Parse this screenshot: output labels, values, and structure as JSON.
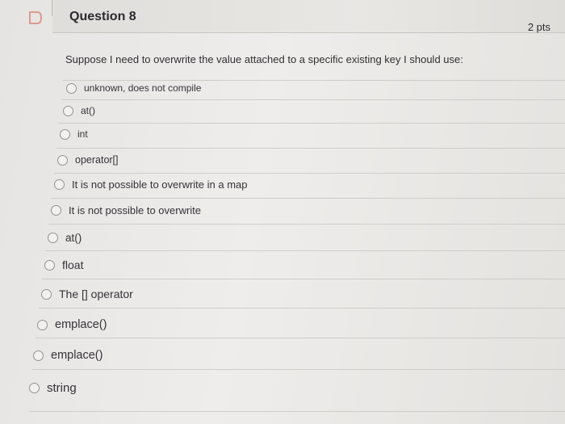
{
  "question": {
    "title": "Question 8",
    "points": "2 pts",
    "prompt": "Suppose I need to overwrite the value attached to a specific existing key I should use:"
  },
  "options": [
    {
      "label": "unknown, does not compile"
    },
    {
      "label": "at()"
    },
    {
      "label": "int"
    },
    {
      "label": "operator[]"
    },
    {
      "label": "It is not possible to overwrite in a map"
    },
    {
      "label": "It is not possible to overwrite"
    },
    {
      "label": "at()"
    },
    {
      "label": "float"
    },
    {
      "label": "The [] operator"
    },
    {
      "label": "emplace()"
    },
    {
      "label": "emplace()"
    },
    {
      "label": "string"
    }
  ]
}
